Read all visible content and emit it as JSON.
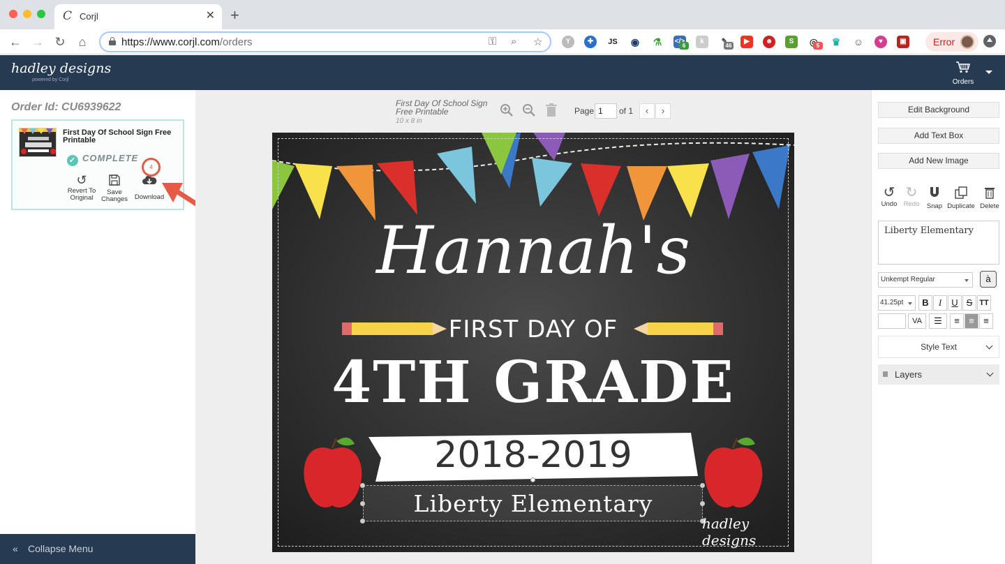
{
  "browser": {
    "tab_title": "Corjl",
    "favicon": "C",
    "url_host": "https://www.corjl.com",
    "url_path": "/orders",
    "error_label": "Error",
    "extension_badges": [
      "6",
      "46",
      "5"
    ]
  },
  "app": {
    "brand": "hadley designs",
    "brand_sub": "powered by Corjl",
    "orders_label": "Orders"
  },
  "order": {
    "id_label": "Order Id: CU6939622",
    "product_title": "First Day Of School Sign Free Printable",
    "status": "COMPLETE",
    "actions": {
      "revert": "Revert To Original",
      "save": "Save Changes",
      "download": "Download"
    },
    "annotation_number": "4",
    "collapse_label": "Collapse Menu"
  },
  "document": {
    "title": "First Day Of School Sign Free Printable",
    "size": "10 x 8 in",
    "page_label": "Page",
    "page_value": "1",
    "of_label": "of 1"
  },
  "canvas": {
    "name": "Hannah's",
    "first_day": "FIRST DAY OF",
    "grade": "4TH GRADE",
    "year": "2018-2019",
    "school": "Liberty Elementary",
    "signature": "hadley designs"
  },
  "right_panel": {
    "edit_background": "Edit Background",
    "add_text_box": "Add Text Box",
    "add_new_image": "Add New Image",
    "tools": {
      "undo": "Undo",
      "redo": "Redo",
      "snap": "Snap",
      "duplicate": "Duplicate",
      "delete": "Delete"
    },
    "text_value": "Liberty Elementary",
    "font_name": "Unkempt Regular",
    "font_size": "41.25pt",
    "style_text": "Style Text",
    "layers": "Layers"
  },
  "colors": {
    "header_bg": "#263a52",
    "accent_teal": "#5cc5b6",
    "annotation_red": "#e55b45",
    "chalkboard": "#2e2e2e"
  }
}
